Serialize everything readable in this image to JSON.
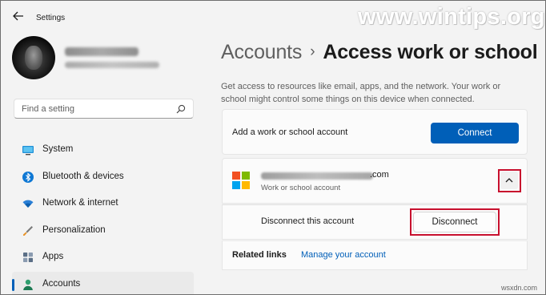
{
  "window": {
    "app_title": "Settings",
    "watermark": "www.wintips.org"
  },
  "search": {
    "placeholder": "Find a setting"
  },
  "sidebar": {
    "items": [
      {
        "label": "System",
        "icon": "monitor-icon"
      },
      {
        "label": "Bluetooth & devices",
        "icon": "bluetooth-icon"
      },
      {
        "label": "Network & internet",
        "icon": "wifi-icon"
      },
      {
        "label": "Personalization",
        "icon": "paintbrush-icon"
      },
      {
        "label": "Apps",
        "icon": "apps-icon"
      },
      {
        "label": "Accounts",
        "icon": "person-icon",
        "selected": true
      }
    ]
  },
  "main": {
    "breadcrumb_parent": "Accounts",
    "breadcrumb_separator": "›",
    "breadcrumb_current": "Access work or school",
    "description": "Get access to resources like email, apps, and the network. Your work or school might control some things on this device when connected.",
    "add_account_label": "Add a work or school account",
    "connect_label": "Connect",
    "account_domain": ".com",
    "account_type": "Work or school account",
    "disconnect_account_label": "Disconnect this account",
    "disconnect_label": "Disconnect",
    "related_links_label": "Related links",
    "manage_account_link": "Manage your account"
  },
  "footer": {
    "source": "wsxdn.com"
  },
  "colors": {
    "accent": "#005fb8",
    "highlight_box": "#c8102e",
    "background": "#f3f3f3",
    "card": "#fbfbfb"
  }
}
